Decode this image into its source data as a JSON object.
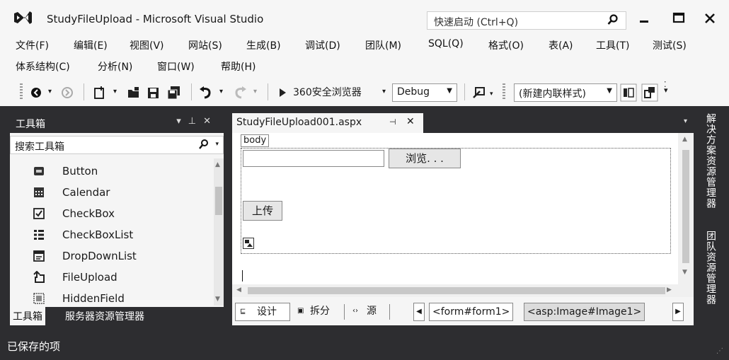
{
  "window": {
    "title": "StudyFileUpload - Microsoft Visual Studio",
    "quick_launch_placeholder": "快速启动 (Ctrl+Q)"
  },
  "menu": {
    "row1": [
      "文件(F)",
      "编辑(E)",
      "视图(V)",
      "网站(S)",
      "生成(B)",
      "调试(D)",
      "团队(M)",
      "SQL(Q)",
      "格式(O)",
      "表(A)",
      "工具(T)",
      "测试(S)"
    ],
    "row2": [
      "体系结构(C)",
      "分析(N)",
      "窗口(W)",
      "帮助(H)"
    ]
  },
  "toolbar": {
    "run_label": "360安全浏览器",
    "config_value": "Debug",
    "style_value": "(新建内联样式)"
  },
  "toolbox": {
    "title": "工具箱",
    "search_placeholder": "搜索工具箱",
    "items": [
      {
        "label": "Button",
        "icon": "button-icon"
      },
      {
        "label": "Calendar",
        "icon": "calendar-icon"
      },
      {
        "label": "CheckBox",
        "icon": "checkbox-icon"
      },
      {
        "label": "CheckBoxList",
        "icon": "checkboxlist-icon"
      },
      {
        "label": "DropDownList",
        "icon": "dropdownlist-icon"
      },
      {
        "label": "FileUpload",
        "icon": "fileupload-icon"
      },
      {
        "label": "HiddenField",
        "icon": "hiddenfield-icon"
      }
    ],
    "tabs": [
      "工具箱",
      "服务器资源管理器"
    ]
  },
  "document": {
    "tab_title": "StudyFileUpload001.aspx",
    "body_tag": "body",
    "browse_label": "浏览. . .",
    "upload_label": "上传"
  },
  "view_bar": {
    "design": "设计",
    "split": "拆分",
    "source": "源",
    "crumbs": [
      "<form#form1>",
      "<asp:Image#Image1>"
    ]
  },
  "side_tabs": [
    "解决方案资源管理器",
    "团队资源管理器"
  ],
  "status": {
    "text": "已保存的项"
  }
}
